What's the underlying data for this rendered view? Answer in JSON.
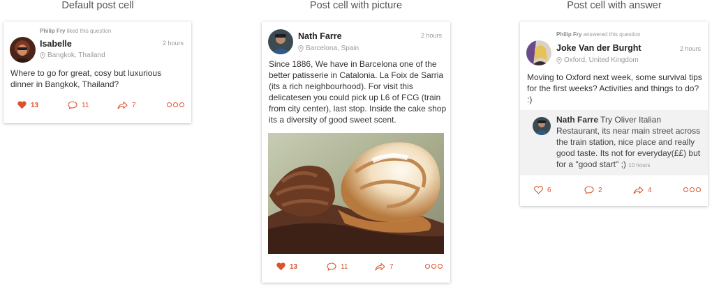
{
  "headings": {
    "default": "Default post cell",
    "picture": "Post cell with picture",
    "answer": "Post cell with answer"
  },
  "colors": {
    "accent": "#d9532c",
    "card_bg": "#ffffff",
    "answer_bg": "#f2f2f2"
  },
  "cards": {
    "default": {
      "liked_by_name": "Philip Fry",
      "liked_by_action": "liked this question",
      "author": "Isabelle",
      "location": "Bangkok, Thailand",
      "time": "2 hours",
      "text": "Where to go for great, cosy but luxurious dinner in Bangkok, Thailand?",
      "likes": "13",
      "comments": "11",
      "shares": "7",
      "liked": true
    },
    "picture": {
      "author": "Nath Farre",
      "location": "Barcelona, Spain",
      "time": "2 hours",
      "text": "Since 1886, We have in Barcelona one of the better patisserie in Catalonia. La Foix de Sarria (its a rich neighbourhood). For visit this delicatesen you could pick up L6 of FCG (train from city center), last stop. Inside the cake shop its a diversity of good sweet scent.",
      "likes": "13",
      "comments": "11",
      "shares": "7",
      "liked": true,
      "image_icon": "cake-photo"
    },
    "answer": {
      "answered_by_name": "Philip Fry",
      "answered_by_action": "answered this question",
      "author": "Joke Van der Burght",
      "location": "Oxford, United Kingdom",
      "time": "2 hours",
      "text": "Moving to Oxford next week, some survival tips for the first weeks? Activities and things to do? :)",
      "answer_author": "Nath Farre",
      "answer_text": "Try Oliver Italian Restaurant, its near main street across the train station, nice place and really good taste. Its not for everyday(££) but for a \"good start\" ;)",
      "answer_time": "10 hours",
      "likes": "6",
      "comments": "2",
      "shares": "4",
      "liked": false
    }
  }
}
